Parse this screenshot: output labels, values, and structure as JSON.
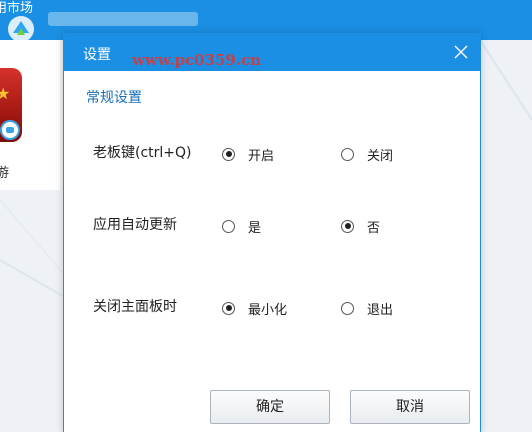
{
  "background": {
    "topbar_text": "用市场",
    "app_label": "游"
  },
  "dialog": {
    "title": "设置",
    "watermark": "www.pc0359.cn",
    "close_icon": "close-icon",
    "section_title": "常规设置",
    "settings": [
      {
        "label": "老板键(ctrl+Q)",
        "options": [
          {
            "label": "开启",
            "checked": true
          },
          {
            "label": "关闭",
            "checked": false
          }
        ]
      },
      {
        "label": "应用自动更新",
        "options": [
          {
            "label": "是",
            "checked": false
          },
          {
            "label": "否",
            "checked": true
          }
        ]
      },
      {
        "label": "关闭主面板时",
        "options": [
          {
            "label": "最小化",
            "checked": true
          },
          {
            "label": "退出",
            "checked": false
          }
        ]
      }
    ],
    "buttons": {
      "ok": "确定",
      "cancel": "取消"
    }
  },
  "colors": {
    "accent": "#1a8fe3",
    "section_title": "#1a6fb8",
    "watermark": "#d9383a"
  }
}
